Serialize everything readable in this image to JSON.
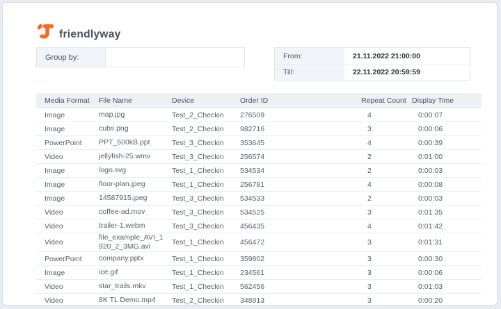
{
  "brand": {
    "name": "friendlyway"
  },
  "colors": {
    "accent": "#F26B24"
  },
  "filters": {
    "group_by_label": "Group by:",
    "group_by_value": "",
    "from_label": "From:",
    "from_value": "21.11.2022 21:00:00",
    "till_label": "Till:",
    "till_value": "22.11.2022 20:59:59"
  },
  "table": {
    "columns": [
      "Media Format",
      "File Name",
      "Device",
      "Order ID",
      "Repeat Count",
      "Display Time"
    ],
    "rows": [
      {
        "format": "Image",
        "file": "map.jpg",
        "device": "Test_2_Checkin",
        "order": "276509",
        "repeat": "4",
        "time": "0:00:07"
      },
      {
        "format": "Image",
        "file": "cubs.png",
        "device": "Test_2_Checkin",
        "order": "982716",
        "repeat": "3",
        "time": "0:00:06"
      },
      {
        "format": "PowerPoint",
        "file": "PPT_500kB.ppt",
        "device": "Test_3_Checkin",
        "order": "353645",
        "repeat": "4",
        "time": "0:00:39"
      },
      {
        "format": "Video",
        "file": "jellyfish-25.wmv",
        "device": "Test_3_Checkin",
        "order": "256574",
        "repeat": "2",
        "time": "0:01:00"
      },
      {
        "format": "Image",
        "file": "logo.svg",
        "device": "Test_1_Checkin",
        "order": "534534",
        "repeat": "2",
        "time": "0:00:03"
      },
      {
        "format": "Image",
        "file": "floor-plan.jpeg",
        "device": "Test_1_Checkin",
        "order": "256781",
        "repeat": "4",
        "time": "0:00:08"
      },
      {
        "format": "Image",
        "file": "14587915.jpeg",
        "device": "Test_3_Checkin",
        "order": "534533",
        "repeat": "2",
        "time": "0:00:03"
      },
      {
        "format": "Video",
        "file": "coffee-ad.mov",
        "device": "Test_3_Checkin",
        "order": "534525",
        "repeat": "3",
        "time": "0:01:35"
      },
      {
        "format": "Video",
        "file": "trailer-1.webm",
        "device": "Test_3_Checkin",
        "order": "456435",
        "repeat": "4",
        "time": "0:01:42"
      },
      {
        "format": "Video",
        "file": "file_example_AVI_1920_2_3MG.avi",
        "device": "Test_1_Checkin",
        "order": "456472",
        "repeat": "3",
        "time": "0:01:31"
      },
      {
        "format": "PowerPoint",
        "file": "company.pptx",
        "device": "Test_1_Checkin",
        "order": "359802",
        "repeat": "3",
        "time": "0:00:30"
      },
      {
        "format": "Image",
        "file": "ice.gif",
        "device": "Test_1_Checkin",
        "order": "234561",
        "repeat": "3",
        "time": "0:00:06"
      },
      {
        "format": "Video",
        "file": "star_trails.mkv",
        "device": "Test_1_Checkin",
        "order": "562456",
        "repeat": "3",
        "time": "0:01:03"
      },
      {
        "format": "Video",
        "file": "8K TL Demo.mp4",
        "device": "Test_2_Checkin",
        "order": "348913",
        "repeat": "3",
        "time": "0:00:20"
      }
    ]
  }
}
